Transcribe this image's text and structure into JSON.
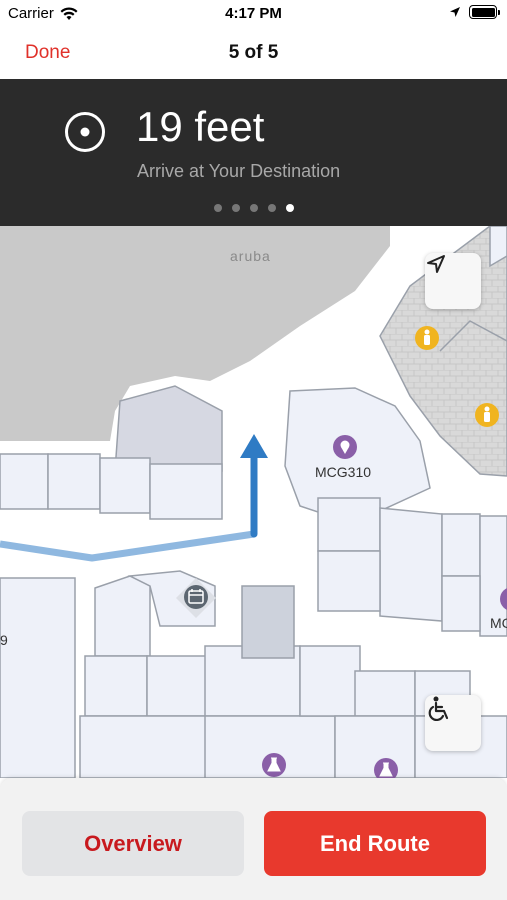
{
  "status_bar": {
    "carrier": "Carrier",
    "time": "4:17 PM"
  },
  "nav": {
    "done_label": "Done",
    "title": "5 of 5"
  },
  "banner": {
    "distance": "19 feet",
    "instruction": "Arrive at Your Destination",
    "steps_total": 5,
    "current_step": 5
  },
  "map": {
    "brand": "aruba",
    "room_labels": [
      "MCG310",
      "9",
      "MC"
    ],
    "icons": [
      "location-pin-icon",
      "restroom-icon",
      "calendar-icon",
      "lab-flask-icon"
    ]
  },
  "buttons": {
    "overview_label": "Overview",
    "end_route_label": "End Route"
  },
  "colors": {
    "accent": "#e0312a",
    "banner_bg": "#2b2b2b",
    "route_active": "#2f7bc4",
    "route_past": "#8fb8e0",
    "restroom": "#f0b420",
    "poi": "#8a5fa8"
  }
}
